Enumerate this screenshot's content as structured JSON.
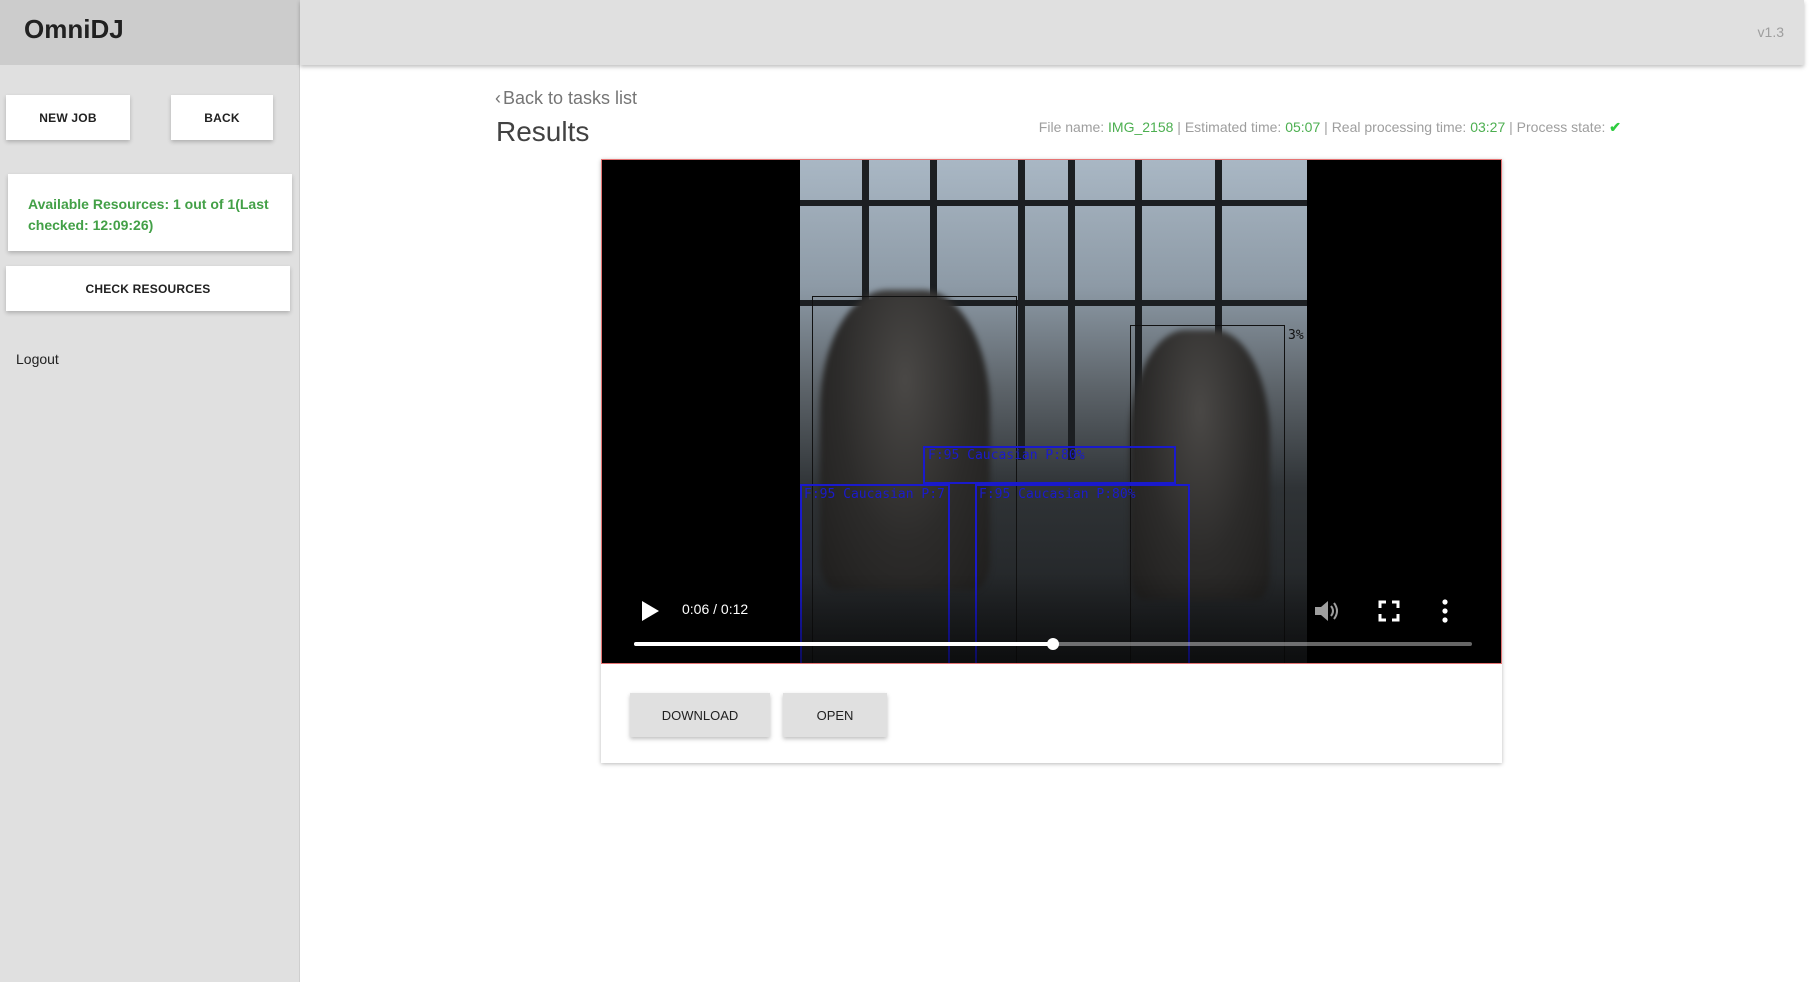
{
  "app": {
    "name": "OmniDJ",
    "version": "v1.3"
  },
  "sidebar": {
    "new_job_label": "NEW JOB",
    "back_label": "BACK",
    "resources_text": "Available Resources: 1 out of 1(Last checked: 12:09:26)",
    "check_resources_label": "CHECK RESOURCES",
    "logout_label": "Logout"
  },
  "main": {
    "back_link": "Back to tasks list",
    "title": "Results",
    "meta": {
      "file_name_label": "File name:",
      "file_name": "IMG_2158",
      "estimated_label": "Estimated time:",
      "estimated_time": "05:07",
      "real_label": "Real processing time:",
      "real_time": "03:27",
      "state_label": "Process state:",
      "state_icon": "check-icon"
    }
  },
  "video": {
    "current_time": "0:06",
    "duration": "0:12",
    "time_display": "0:06 / 0:12",
    "progress_fraction": 0.5,
    "detections": [
      {
        "label": "F:95 Caucasian P:80%"
      },
      {
        "label": "F:95 Caucasian P:7"
      },
      {
        "label": "F:95 Caucasian P:80%"
      },
      {
        "label": "3%"
      }
    ]
  },
  "actions": {
    "download_label": "DOWNLOAD",
    "open_label": "OPEN"
  },
  "colors": {
    "accent_green": "#4caf50",
    "detection_blue": "#1a1acc",
    "sidebar_bg": "#e0e0e0"
  }
}
